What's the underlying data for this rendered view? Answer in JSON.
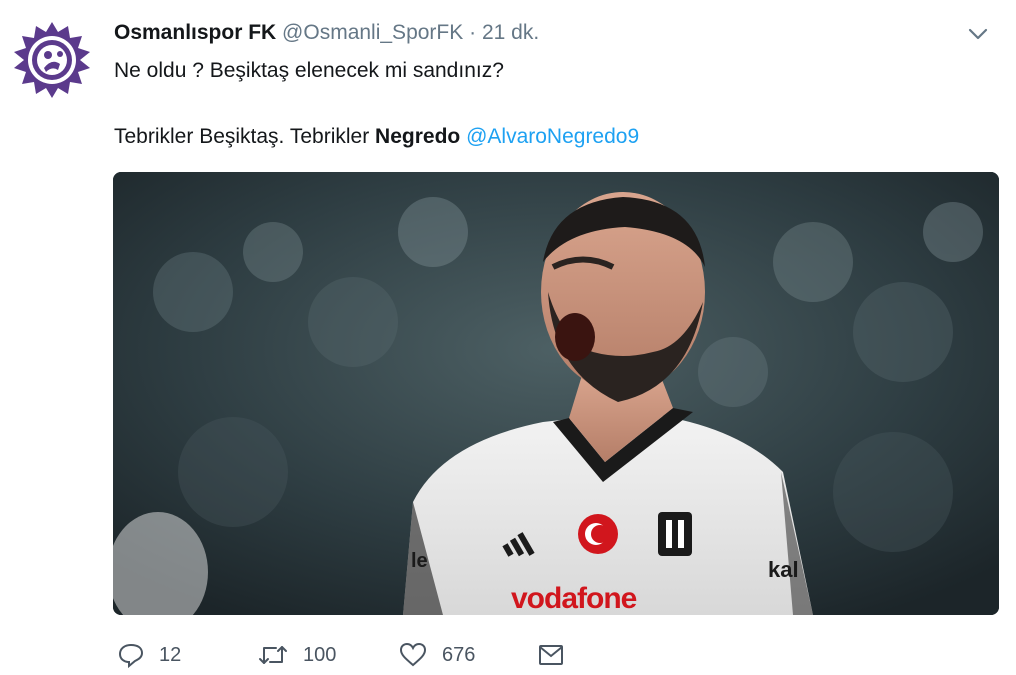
{
  "tweet": {
    "author_name": "Osmanlıspor FK",
    "author_handle": "@Osmanli_SporFK",
    "separator": "·",
    "time": "21 dk.",
    "line1": "Ne oldu ? Beşiktaş elenecek mi sandınız?",
    "line2_text": "Tebrikler Beşiktaş. Tebrikler ",
    "line2_bold": "Negredo",
    "line2_mention": "@AlvaroNegredo9",
    "media": {
      "jersey_sponsor": "vodafone",
      "sleeve_text": "kal",
      "collar_text": "le"
    }
  },
  "actions": {
    "reply_count": "12",
    "retweet_count": "100",
    "like_count": "676"
  },
  "icons": {
    "reply": "reply-icon",
    "retweet": "retweet-icon",
    "like": "heart-icon",
    "dm": "envelope-icon",
    "menu": "chevron-down-icon"
  },
  "colors": {
    "link": "#1da1f2",
    "muted": "#657786",
    "brand_purple": "#5b3a8c"
  }
}
